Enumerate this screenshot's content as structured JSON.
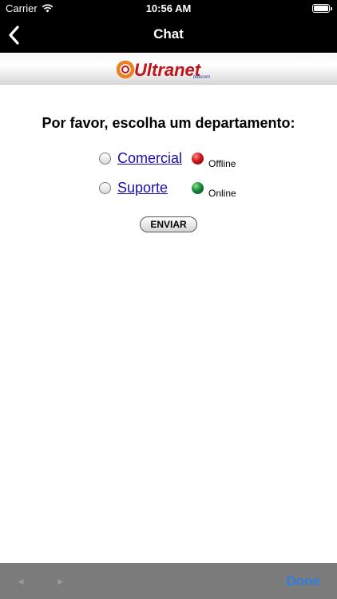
{
  "status_bar": {
    "carrier": "Carrier",
    "time": "10:56 AM",
    "battery_level": 1.0
  },
  "nav": {
    "title": "Chat",
    "back_icon": "chevron-left-icon"
  },
  "banner": {
    "logo_text": "Ultranet",
    "logo_subtext": "telecom"
  },
  "content": {
    "prompt": "Por favor, escolha um departamento:",
    "departments": [
      {
        "name": "Comercial",
        "status": "Offline",
        "status_color": "#c0141a",
        "selected": false
      },
      {
        "name": "Suporte",
        "status": "Online",
        "status_color": "#1a8a3a",
        "selected": false
      }
    ],
    "submit_label": "ENVIAR"
  },
  "toolbar": {
    "back_icon": "triangle-left-icon",
    "forward_icon": "triangle-right-icon",
    "back_glyph": "◄",
    "forward_glyph": "►",
    "done_label": "Done"
  },
  "colors": {
    "link": "#1a0dab",
    "done": "#2f7fe0",
    "toolbar_bg": "#7b7b7b"
  }
}
